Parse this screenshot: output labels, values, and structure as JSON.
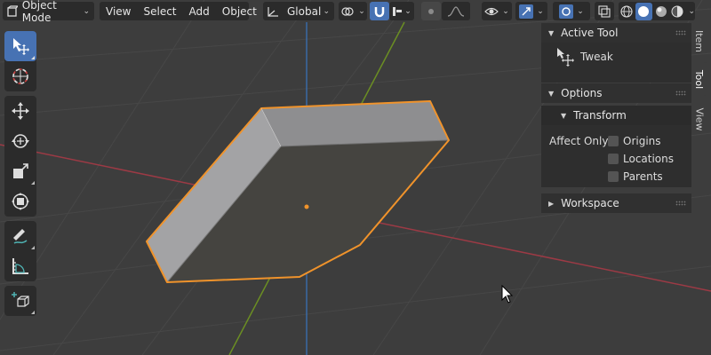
{
  "header": {
    "mode": "Object Mode",
    "menus": [
      "View",
      "Select",
      "Add",
      "Object"
    ],
    "orientation": "Global"
  },
  "sidebar": {
    "active_tool_title": "Active Tool",
    "active_tool_name": "Tweak",
    "options_title": "Options",
    "transform_title": "Transform",
    "affect_only_label": "Affect Only",
    "checkboxes": [
      "Origins",
      "Locations",
      "Parents"
    ],
    "workspace_title": "Workspace"
  },
  "tabs": [
    "Item",
    "Tool",
    "View"
  ],
  "colors": {
    "accent": "#4772b3",
    "selection": "#f0932b",
    "x_axis": "#9c3a45",
    "y_axis": "#6b8e23",
    "z_axis": "#3a6aa5"
  },
  "icons": {
    "toolbar": [
      "select-box-icon",
      "cursor-icon",
      "move-icon",
      "rotate-icon",
      "scale-icon",
      "transform-icon",
      "annotate-icon",
      "measure-icon",
      "add-cube-icon"
    ]
  }
}
